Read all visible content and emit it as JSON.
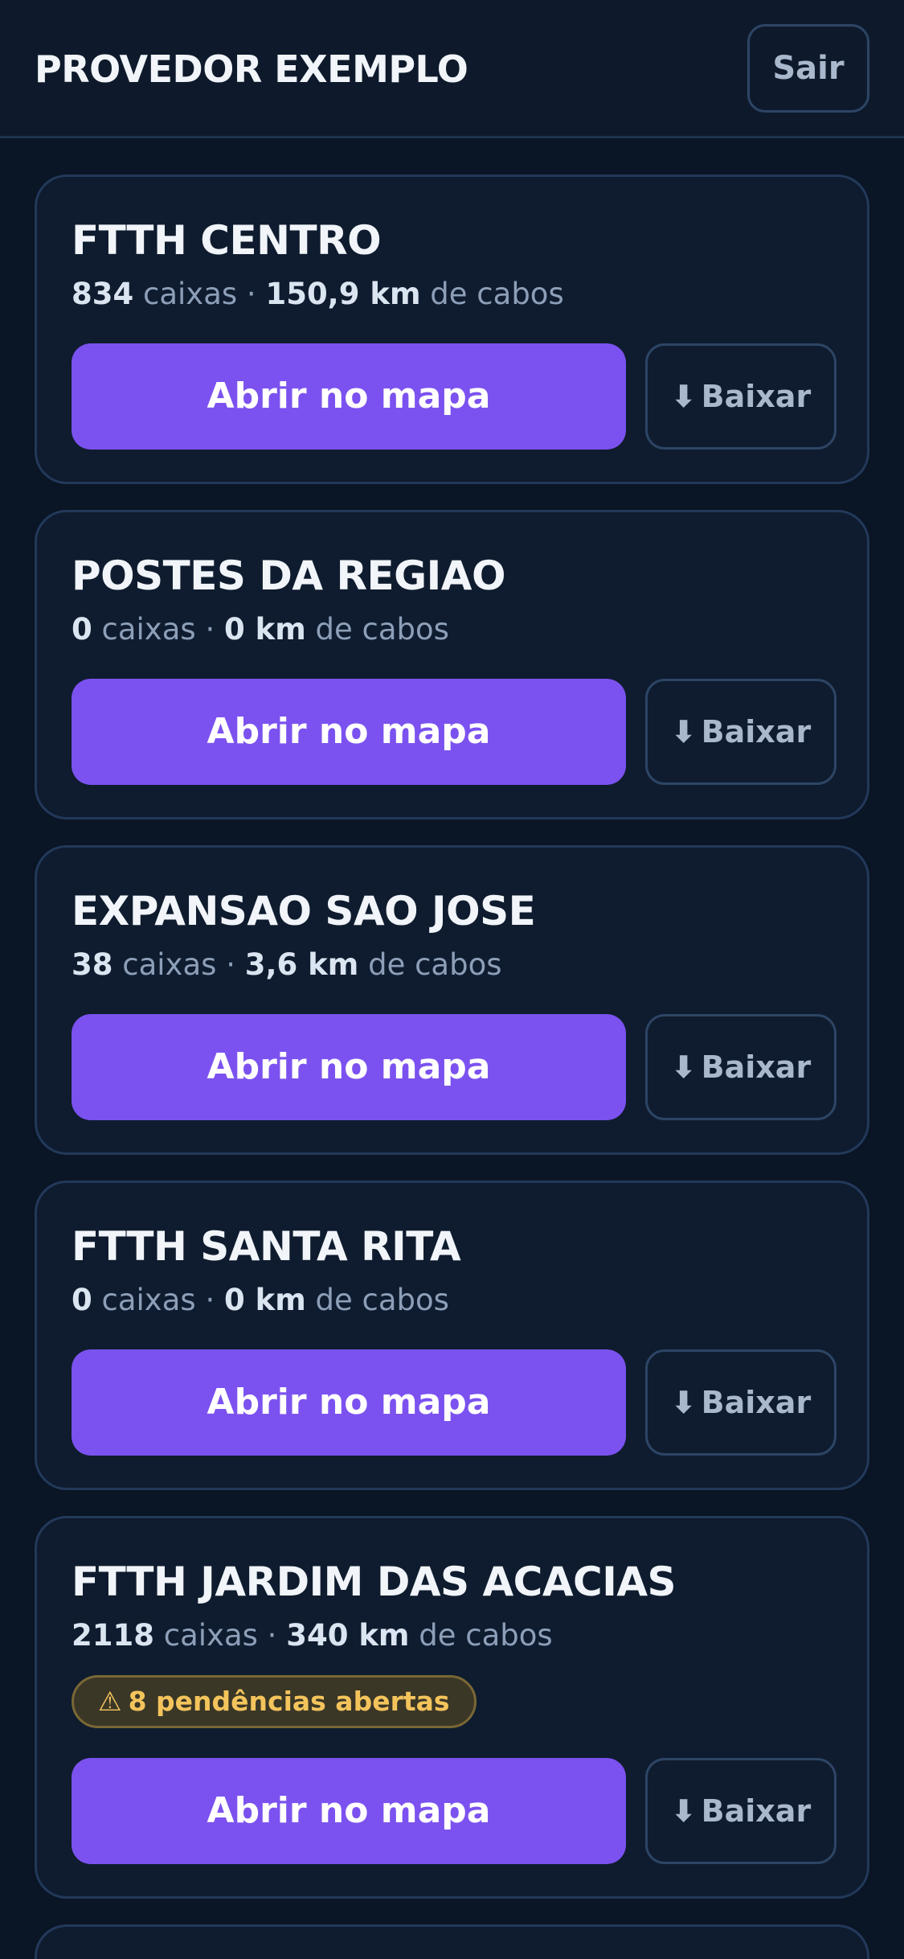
{
  "header": {
    "brand": "PROVEDOR EXEMPLO",
    "logout_label": "Sair"
  },
  "projects": [
    {
      "name": "FTTH CENTRO",
      "boxes": "834",
      "boxes_label": "caixas",
      "separator": "·",
      "cable_length": "150,9 km",
      "cable_label": "de cabos",
      "open_label": "Abrir no mapa",
      "download_icon": "⬇",
      "download_label": "Baixar"
    },
    {
      "name": "POSTES DA REGIAO",
      "boxes": "0",
      "boxes_label": "caixas",
      "separator": "·",
      "cable_length": "0 km",
      "cable_label": "de cabos",
      "open_label": "Abrir no mapa",
      "download_icon": "⬇",
      "download_label": "Baixar"
    },
    {
      "name": "EXPANSAO SAO JOSE",
      "boxes": "38",
      "boxes_label": "caixas",
      "separator": "·",
      "cable_length": "3,6 km",
      "cable_label": "de cabos",
      "open_label": "Abrir no mapa",
      "download_icon": "⬇",
      "download_label": "Baixar"
    },
    {
      "name": "FTTH SANTA RITA",
      "boxes": "0",
      "boxes_label": "caixas",
      "separator": "·",
      "cable_length": "0 km",
      "cable_label": "de cabos",
      "open_label": "Abrir no mapa",
      "download_icon": "⬇",
      "download_label": "Baixar"
    },
    {
      "name": "FTTH JARDIM DAS ACACIAS",
      "boxes": "2118",
      "boxes_label": "caixas",
      "separator": "·",
      "cable_length": "340 km",
      "cable_label": "de cabos",
      "warning_icon": "⚠",
      "pending_label": "8 pendências abertas",
      "open_label": "Abrir no mapa",
      "download_icon": "⬇",
      "download_label": "Baixar"
    }
  ],
  "colors": {
    "background": "#0a1525",
    "card": "#0f1c2f",
    "accent": "#7b52ef",
    "warning": "#f4c45c"
  }
}
